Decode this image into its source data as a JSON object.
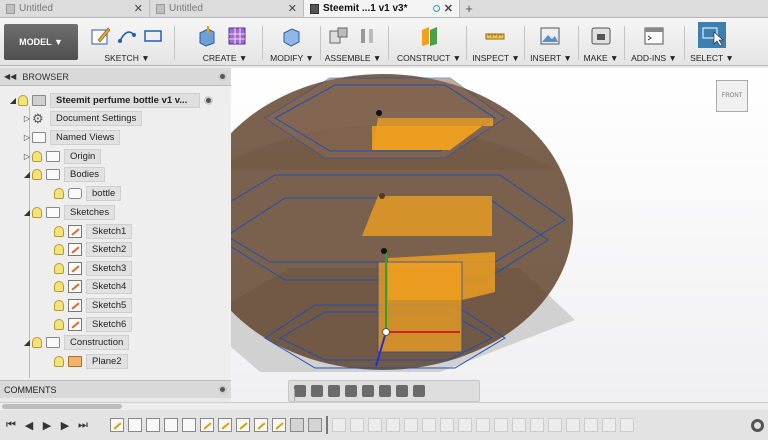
{
  "tabs": [
    {
      "label": "Untitled"
    },
    {
      "label": "Untitled"
    },
    {
      "label": "Steemit ...1 v1 v3*"
    }
  ],
  "toolbar": {
    "model_label": "MODEL ▼",
    "groups": [
      {
        "label": "SKETCH ▼"
      },
      {
        "label": "CREATE ▼"
      },
      {
        "label": "MODIFY ▼"
      },
      {
        "label": "ASSEMBLE ▼"
      },
      {
        "label": "CONSTRUCT ▼"
      },
      {
        "label": "INSPECT ▼"
      },
      {
        "label": "INSERT ▼"
      },
      {
        "label": "MAKE ▼"
      },
      {
        "label": "ADD-INS ▼"
      },
      {
        "label": "SELECT ▼"
      }
    ]
  },
  "browser": {
    "title": "BROWSER",
    "items": [
      {
        "label": "Steemit perfume bottle v1 v..."
      },
      {
        "label": "Document Settings"
      },
      {
        "label": "Named Views"
      },
      {
        "label": "Origin"
      },
      {
        "label": "Bodies"
      },
      {
        "label": "bottle"
      },
      {
        "label": "Sketches"
      },
      {
        "label": "Sketch1"
      },
      {
        "label": "Sketch2"
      },
      {
        "label": "Sketch3"
      },
      {
        "label": "Sketch4"
      },
      {
        "label": "Sketch5"
      },
      {
        "label": "Sketch6"
      },
      {
        "label": "Construction"
      },
      {
        "label": "Plane2"
      }
    ]
  },
  "comments": {
    "title": "COMMENTS"
  },
  "viewcube": {
    "label": "FRONT"
  },
  "colors": {
    "accent": "#1e5fb4",
    "plane_fill": "#f0a020",
    "body_fill": "#5a3b22"
  }
}
